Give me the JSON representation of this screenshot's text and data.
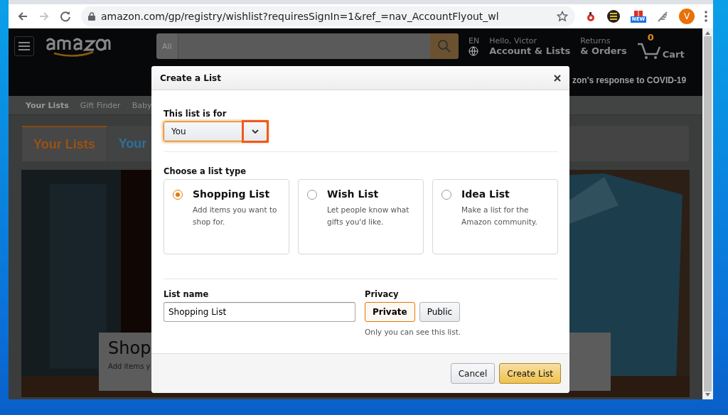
{
  "browser": {
    "url": "amazon.com/gp/registry/wishlist?requiresSignIn=1&ref_=nav_AccountFlyout_wl",
    "forward_disabled": true,
    "extension_badge": "NEW",
    "profile_initial": "V"
  },
  "page": {
    "nav": {
      "search_scope": "All",
      "language": "EN",
      "greeting": "Hello, Victor",
      "account": "Account & Lists",
      "returns": "Returns",
      "orders": "& Orders",
      "cart_count": "0",
      "cart": "Cart",
      "notice": "zon's response to COVID-19"
    },
    "subnav": [
      "Your Lists",
      "Gift Finder",
      "Baby"
    ],
    "tabs": [
      {
        "label": "Your Lists",
        "selected": true
      },
      {
        "label": "Your",
        "selected": false
      }
    ],
    "banner": {
      "title": "Shop",
      "text": "Add items y"
    }
  },
  "dialog": {
    "title": "Create a List",
    "for_label": "This list is for",
    "for_value": "You",
    "arrow_highlighted": true,
    "type_label": "Choose a list type",
    "types": [
      {
        "name": "Shopping List",
        "description": "Add items you want to shop for.",
        "selected": true
      },
      {
        "name": "Wish List",
        "description": "Let people know what gifts you'd like.",
        "selected": false
      },
      {
        "name": "Idea List",
        "description": "Make a list for the Amazon community.",
        "selected": false
      }
    ],
    "name_label": "List name",
    "name_value": "Shopping List",
    "privacy_label": "Privacy",
    "privacy": [
      {
        "label": "Private",
        "selected": true
      },
      {
        "label": "Public",
        "selected": false
      }
    ],
    "privacy_note": "Only you can see this list.",
    "cancel": "Cancel",
    "create": "Create List"
  }
}
